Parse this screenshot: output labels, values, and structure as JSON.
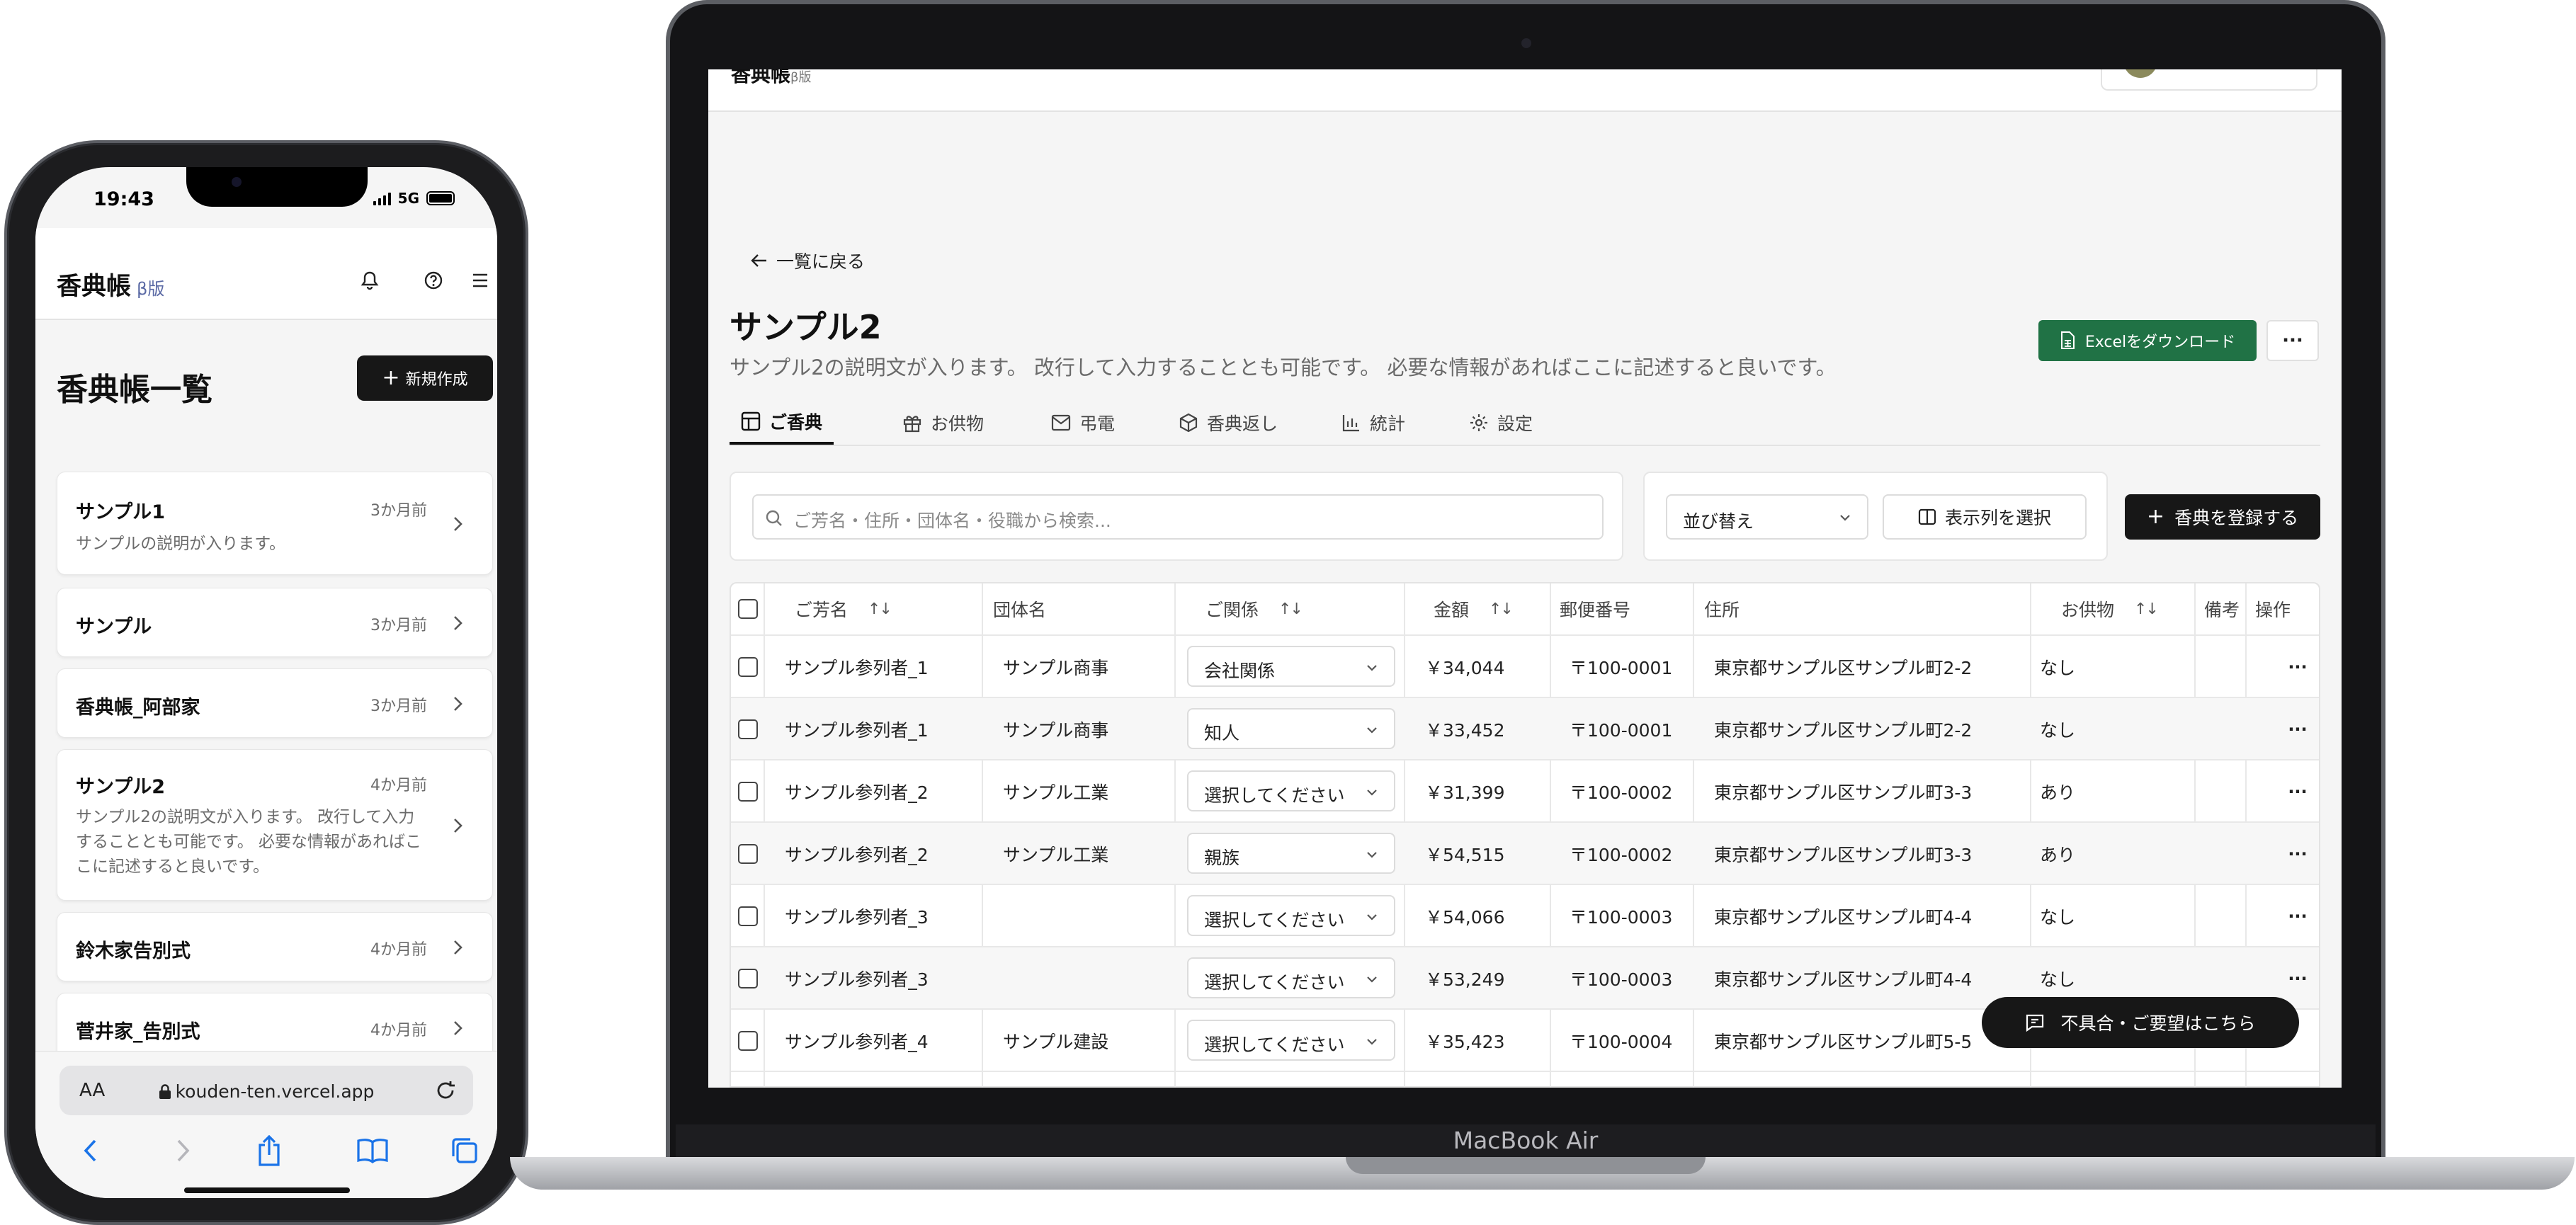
{
  "phone": {
    "status": {
      "time": "19:43",
      "network": "5G"
    },
    "app_title": "香典帳",
    "beta_label": "β版",
    "page_title": "香典帳一覧",
    "new_button": "新規作成",
    "cards": [
      {
        "name": "サンプル1",
        "ago": "3か月前",
        "desc": "サンプルの説明が入ります。"
      },
      {
        "name": "サンプル",
        "ago": "3か月前",
        "desc": ""
      },
      {
        "name": "香典帳_阿部家",
        "ago": "3か月前",
        "desc": ""
      },
      {
        "name": "サンプル2",
        "ago": "4か月前",
        "desc": "サンプル2の説明文が入ります。 改行して入力することとも可能です。 必要な情報があればここに記述すると良いです。"
      },
      {
        "name": "鈴木家告別式",
        "ago": "4か月前",
        "desc": ""
      },
      {
        "name": "菅井家_告別式",
        "ago": "4か月前",
        "desc": ""
      }
    ],
    "url_prefix": "AA",
    "url": "kouden-ten.vercel.app"
  },
  "laptop": {
    "model_label": "MacBook Air",
    "back_link": "一覧に戻る",
    "title": "サンプル2",
    "description": "サンプル2の説明文が入ります。 改行して入力することとも可能です。 必要な情報があればここに記述すると良いです。",
    "excel_button": "Excelをダウンロード",
    "more_button": "···",
    "tabs": [
      "ご香典",
      "お供物",
      "弔電",
      "香典返し",
      "統計",
      "設定"
    ],
    "search_placeholder": "ご芳名・住所・団体名・役職から検索...",
    "sort_label": "並び替え",
    "columns_button": "表示列を選択",
    "register_button": "香典を登録する",
    "table": {
      "headers": [
        "ご芳名",
        "団体名",
        "ご関係",
        "金額",
        "郵便番号",
        "住所",
        "お供物",
        "備考",
        "操作"
      ],
      "rows": [
        {
          "name": "サンプル参列者_1",
          "org": "サンプル商事",
          "relation": "会社関係",
          "amount": "￥34,044",
          "zip": "〒100-0001",
          "address": "東京都サンプル区サンプル町2-2",
          "offering": "なし"
        },
        {
          "name": "サンプル参列者_1",
          "org": "サンプル商事",
          "relation": "知人",
          "amount": "￥33,452",
          "zip": "〒100-0001",
          "address": "東京都サンプル区サンプル町2-2",
          "offering": "なし"
        },
        {
          "name": "サンプル参列者_2",
          "org": "サンプル工業",
          "relation": "選択してください",
          "amount": "￥31,399",
          "zip": "〒100-0002",
          "address": "東京都サンプル区サンプル町3-3",
          "offering": "あり"
        },
        {
          "name": "サンプル参列者_2",
          "org": "サンプル工業",
          "relation": "親族",
          "amount": "￥54,515",
          "zip": "〒100-0002",
          "address": "東京都サンプル区サンプル町3-3",
          "offering": "あり"
        },
        {
          "name": "サンプル参列者_3",
          "org": "",
          "relation": "選択してください",
          "amount": "￥54,066",
          "zip": "〒100-0003",
          "address": "東京都サンプル区サンプル町4-4",
          "offering": "なし"
        },
        {
          "name": "サンプル参列者_3",
          "org": "",
          "relation": "選択してください",
          "amount": "￥53,249",
          "zip": "〒100-0003",
          "address": "東京都サンプル区サンプル町4-4",
          "offering": "なし"
        },
        {
          "name": "サンプル参列者_4",
          "org": "サンプル建設",
          "relation": "選択してください",
          "amount": "￥35,423",
          "zip": "〒100-0004",
          "address": "東京都サンプル区サンプル町5-5",
          "offering": ""
        }
      ],
      "row_menu": "···"
    },
    "feedback_button": "不具合・ご要望はこちら"
  }
}
